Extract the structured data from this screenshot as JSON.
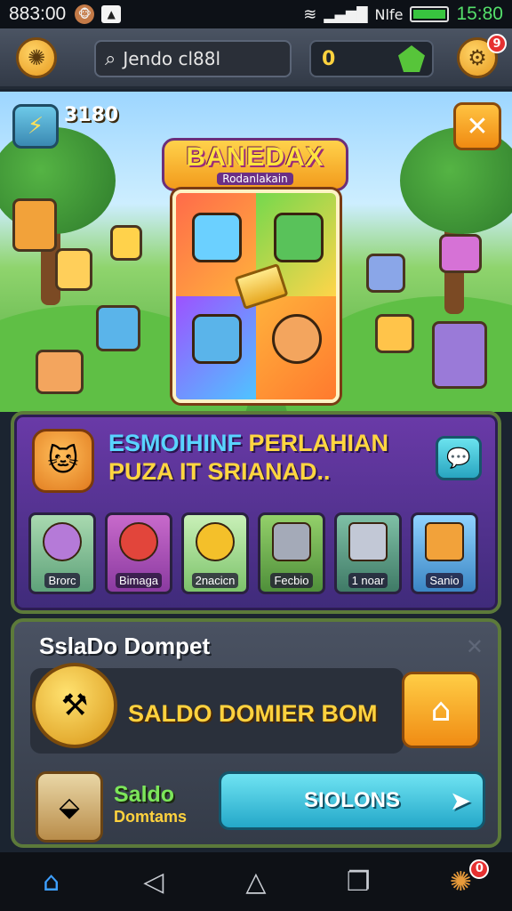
{
  "status_bar": {
    "time": "883:00",
    "network": "Nlfe",
    "clock": "15:80"
  },
  "top_bar": {
    "search_text": "Jendo cl88l",
    "coins": "0",
    "settings_badge": "9"
  },
  "scene": {
    "score": "3180",
    "banner_title": "BANEDAX",
    "banner_subtitle": "Rodanlakain"
  },
  "puzzle_panel": {
    "title_line1_a": "ESMOIHINF",
    "title_line1_b": "PERLAHIAN",
    "title_line2": "PUZA IT SRIANAD..",
    "items": [
      {
        "label": "Brorc"
      },
      {
        "label": "Bimaga"
      },
      {
        "label": "2nacicn"
      },
      {
        "label": "Fecbio"
      },
      {
        "label": "1 noar"
      },
      {
        "label": "Sanio"
      }
    ]
  },
  "wallet": {
    "title": "SslaDo Dompet",
    "big_label": "SALDO DOMIER BOM",
    "small_label_1": "Saldo",
    "small_label_2": "Domtams",
    "button_label": "SIOLONS"
  },
  "nav_bar": {
    "badge": "0"
  },
  "colors": {
    "accent_orange": "#f29a1c",
    "accent_cyan": "#24a8c9",
    "panel_purple": "#6a3aa8",
    "gold_text": "#ffd23e"
  }
}
